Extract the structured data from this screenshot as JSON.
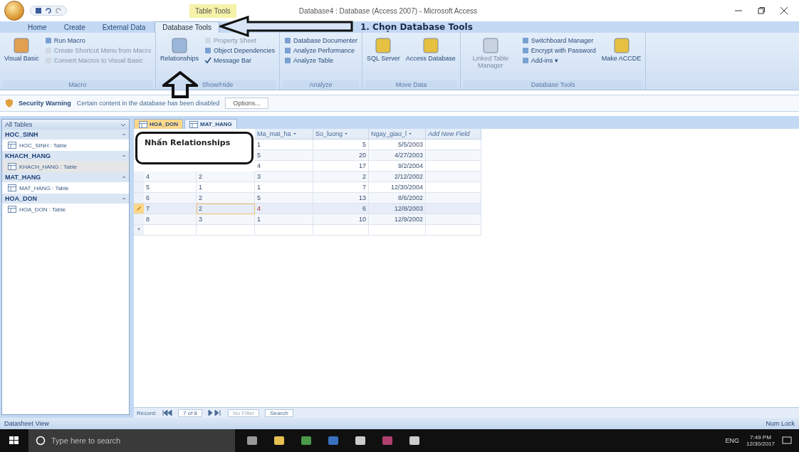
{
  "window": {
    "title": "Database4 : Database (Access 2007) - Microsoft Access",
    "context_tab": "Table Tools"
  },
  "ribbon": {
    "tabs": [
      {
        "label": "Home",
        "selected": false
      },
      {
        "label": "Create",
        "selected": false
      },
      {
        "label": "External Data",
        "selected": false
      },
      {
        "label": "Database Tools",
        "selected": true
      }
    ],
    "groups": [
      {
        "name": "Macro",
        "large": [
          {
            "label": "Visual Basic",
            "disabled": false
          }
        ],
        "small": [
          {
            "label": "Run Macro",
            "disabled": false
          },
          {
            "label": "Create Shortcut Menu from Macro",
            "disabled": true
          },
          {
            "label": "Convert Macros to Visual Basic",
            "disabled": true
          }
        ]
      },
      {
        "name": "Show/Hide",
        "large": [
          {
            "label": "Relationships",
            "disabled": false
          }
        ],
        "small": [
          {
            "label": "Property Sheet",
            "disabled": true
          },
          {
            "label": "Object Dependencies",
            "disabled": false
          },
          {
            "label": "Message Bar",
            "disabled": false,
            "checked": true
          }
        ]
      },
      {
        "name": "Analyze",
        "small": [
          {
            "label": "Database Documenter",
            "disabled": false
          },
          {
            "label": "Analyze Performance",
            "disabled": false
          },
          {
            "label": "Analyze Table",
            "disabled": false
          }
        ]
      },
      {
        "name": "Move Data",
        "large": [
          {
            "label": "SQL Server",
            "disabled": false
          },
          {
            "label": "Access Database",
            "disabled": false
          }
        ]
      },
      {
        "name": "Database Tools",
        "large": [
          {
            "label": "Linked Table Manager",
            "disabled": true
          }
        ],
        "small": [
          {
            "label": "Switchboard Manager",
            "disabled": false
          },
          {
            "label": "Encrypt with Password",
            "disabled": false
          },
          {
            "label": "Add-ins ▾",
            "disabled": false
          }
        ],
        "large_after": [
          {
            "label": "Make ACCDE",
            "disabled": false
          }
        ]
      }
    ]
  },
  "security_bar": {
    "title": "Security Warning",
    "message": "Certain content in the database has been disabled",
    "button": "Options..."
  },
  "nav_pane": {
    "title": "All Tables",
    "groups": [
      {
        "name": "HOC_SINH",
        "item": "HOC_SINH : Table",
        "selected": false
      },
      {
        "name": "KHACH_HANG",
        "item": "KHACH_HANG : Table",
        "selected": true
      },
      {
        "name": "MAT_HANG",
        "item": "MAT_HANG : Table",
        "selected": false
      },
      {
        "name": "HOA_DON",
        "item": "HOA_DON : Table",
        "selected": false
      }
    ]
  },
  "doc_tabs": [
    {
      "label": "HOA_DON",
      "selected": true
    },
    {
      "label": "MAT_HANG",
      "selected": false
    }
  ],
  "table": {
    "columns": [
      "Ma_mat_ha",
      "So_luong",
      "Ngay_giao_l",
      "Add New Field"
    ],
    "rows": [
      {
        "ma_mat_hang": "1",
        "so_luong": "5",
        "ngay_giao": "5/5/2003",
        "selected": false
      },
      {
        "ma_mat_hang": "5",
        "so_luong": "20",
        "ngay_giao": "4/27/2003",
        "selected": false
      },
      {
        "ma_mat_hang": "4",
        "so_luong": "17",
        "ngay_giao": "9/2/2004",
        "selected": false
      },
      {
        "column_1": "4",
        "column_2": "2",
        "ma_mat_hang": "3",
        "so_luong": "2",
        "ngay_giao": "2/12/2002",
        "selected": false
      },
      {
        "column_1": "5",
        "column_2": "1",
        "ma_mat_hang": "1",
        "so_luong": "7",
        "ngay_giao": "12/30/2004",
        "selected": false
      },
      {
        "column_1": "6",
        "column_2": "2",
        "ma_mat_hang": "5",
        "so_luong": "13",
        "ngay_giao": "8/6/2002",
        "selected": false
      },
      {
        "column_1": "7",
        "column_2": "2",
        "ma_mat_hang": "4",
        "so_luong": "6",
        "ngay_giao": "12/8/2003",
        "selected": true
      },
      {
        "column_1": "8",
        "column_2": "3",
        "ma_mat_hang": "1",
        "so_luong": "10",
        "ngay_giao": "12/9/2002",
        "selected": false
      }
    ],
    "new_row_marker": "*"
  },
  "record_nav": {
    "label": "Record:",
    "position": "7 of 8",
    "filter": "No Filter",
    "search": "Search"
  },
  "status_bar": {
    "left": "Datasheet View",
    "right": "Num Lock"
  },
  "annotations": [
    {
      "kind": "left-arrow",
      "label": "1. Chọn Database Tools"
    },
    {
      "kind": "up-arrow",
      "label": "Nhấn Relationships"
    }
  ],
  "taskbar": {
    "search_placeholder": "Type here to search",
    "language": "ENG",
    "time": "7:49 PM",
    "date": "12/30/2017"
  }
}
